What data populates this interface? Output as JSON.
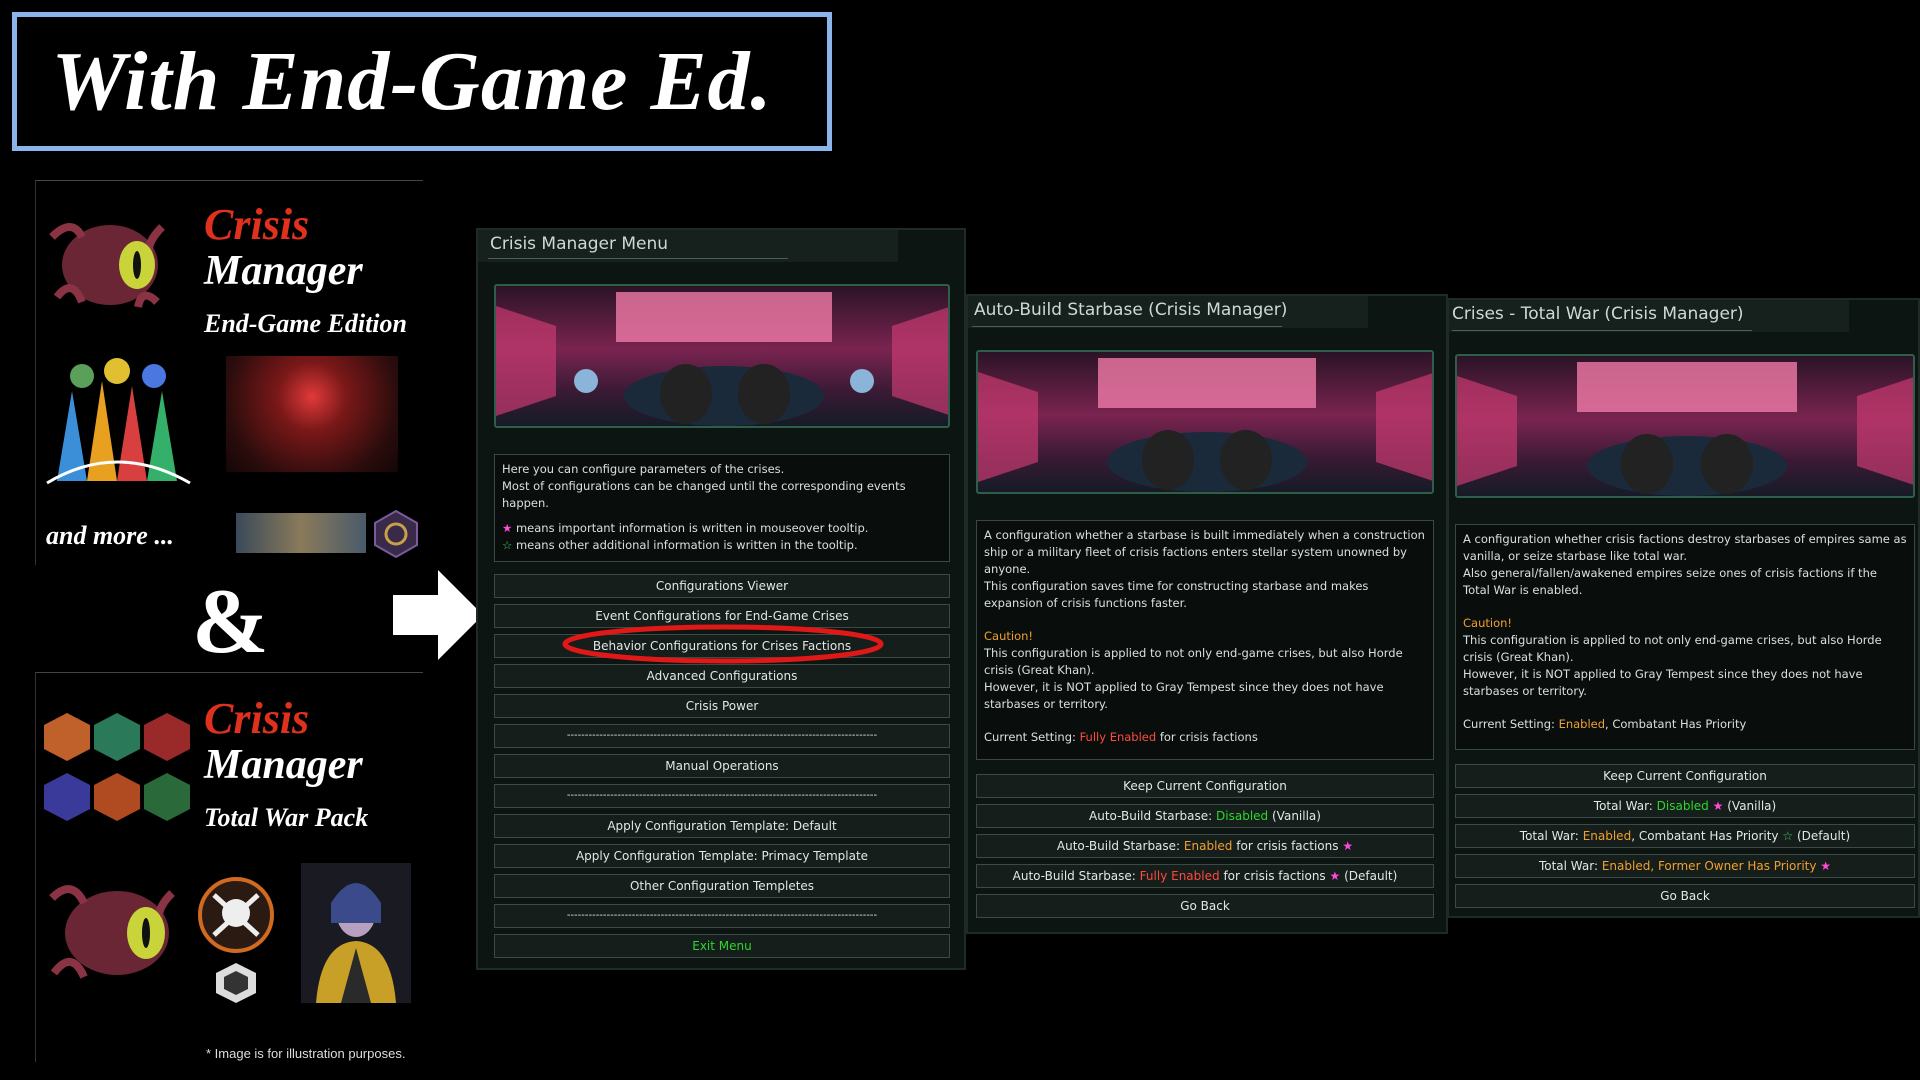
{
  "title": "With End-Game Ed.",
  "promo_top": {
    "title_line1": "Crisis",
    "title_line2": "Manager",
    "subtitle": "End-Game Edition",
    "and_more": "and more ..."
  },
  "ampersand": "&",
  "promo_bottom": {
    "title_line1": "Crisis",
    "title_line2": "Manager",
    "subtitle": "Total War Pack",
    "note": "* Image is for illustration purposes."
  },
  "menu": {
    "title": "Crisis Manager Menu",
    "desc_line1": "Here you can configure parameters of the crises.",
    "desc_line2": "Most of configurations can be changed until the corresponding events happen.",
    "legend_pink": "means important information is written in mouseover tooltip.",
    "legend_green": "means other additional information is written in the tooltip.",
    "options": [
      "Configurations Viewer",
      "Event Configurations for End-Game Crises",
      "Behavior Configurations for Crises Factions",
      "Advanced Configurations",
      "Crisis Power",
      "--------------------------------------------------------------------------------------",
      "Manual Operations",
      "--------------------------------------------------------------------------------------",
      "Apply Configuration Template: Default",
      "Apply Configuration Template: Primacy Template",
      "Other Configuration Templetes",
      "--------------------------------------------------------------------------------------",
      "Exit Menu"
    ],
    "highlighted_option_index": 2
  },
  "starbase": {
    "title": "Auto-Build Starbase (Crisis Manager)",
    "desc1": "A configuration whether a starbase is built immediately when a construction ship or a military fleet of crisis factions enters stellar system unowned by anyone.",
    "desc2": "This configuration saves time for constructing starbase and makes expansion of crisis functions faster.",
    "caution": "Caution!",
    "caution1": "This configuration is applied to not only end-game crises, but also Horde crisis (Great Khan).",
    "caution2": "However, it is NOT applied to Gray Tempest since they does not have starbases or territory.",
    "current_label": "Current Setting:",
    "current_value": "Fully Enabled",
    "current_suffix": "for crisis factions",
    "opt_keep": "Keep Current Configuration",
    "opt1_pre": "Auto-Build Starbase:",
    "opt1_val": "Disabled",
    "opt1_post": "(Vanilla)",
    "opt2_pre": "Auto-Build Starbase:",
    "opt2_val": "Enabled",
    "opt2_post": "for crisis factions",
    "opt3_pre": "Auto-Build Starbase:",
    "opt3_val": "Fully Enabled",
    "opt3_post": "for crisis factions",
    "opt3_tail": "(Default)",
    "opt_back": "Go Back"
  },
  "totalwar": {
    "title": "Crises - Total War (Crisis Manager)",
    "desc1": "A configuration whether crisis factions destroy starbases of empires same as vanilla, or seize starbase like total war.",
    "desc2": "Also general/fallen/awakened empires seize ones of crisis factions if the Total War is enabled.",
    "caution": "Caution!",
    "caution1": "This configuration is applied to not only end-game crises, but also Horde crisis (Great Khan).",
    "caution2": "However, it is NOT applied to Gray Tempest since they does not have starbases or territory.",
    "current_label": "Current Setting:",
    "current_value": "Enabled",
    "current_suffix": ", Combatant Has Priority",
    "opt_keep": "Keep Current Configuration",
    "opt1_pre": "Total War:",
    "opt1_val": "Disabled",
    "opt1_post": "(Vanilla)",
    "opt2_pre": "Total War:",
    "opt2_val": "Enabled",
    "opt2_post": ", Combatant Has Priority",
    "opt2_tail": "(Default)",
    "opt3_pre": "Total War:",
    "opt3_val": "Enabled",
    "opt3_post": ", Former Owner Has Priority",
    "opt_back": "Go Back"
  },
  "colors": {
    "highlight_ring": "#e01818",
    "title_border": "#8ab4ea",
    "crisis_red": "#e0301e",
    "enabled_orange": "#f0a030",
    "disabled_green": "#2ed62e"
  },
  "icons": [
    "crisis-creature-icon",
    "faction-emblems-icon",
    "skull-icon",
    "star-icon"
  ]
}
